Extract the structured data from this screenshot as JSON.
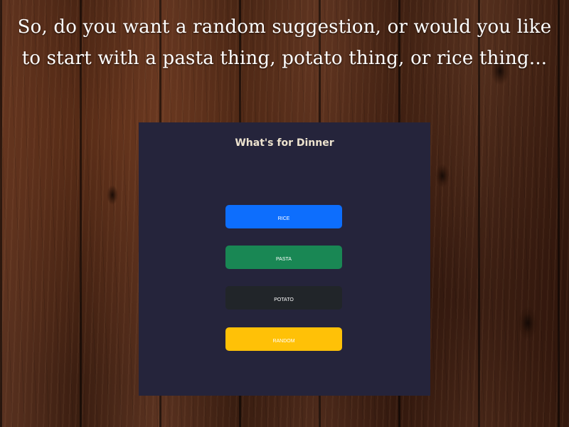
{
  "caption": {
    "line1": "So, do you want a random suggestion, or would you like",
    "line2": "to start with a pasta thing, potato thing, or rice thing..."
  },
  "app": {
    "title": "What's for Dinner",
    "buttons": [
      {
        "label": "RICE",
        "color": "#0d6efd"
      },
      {
        "label": "PASTA",
        "color": "#198754"
      },
      {
        "label": "POTATO",
        "color": "#212529"
      },
      {
        "label": "RANDOM",
        "color": "#ffc107"
      }
    ]
  },
  "colors": {
    "panel_background": "#25243b",
    "title_text": "#ede3cf",
    "caption_text": "#ffffff",
    "wood_background": "#4a2a1a"
  }
}
